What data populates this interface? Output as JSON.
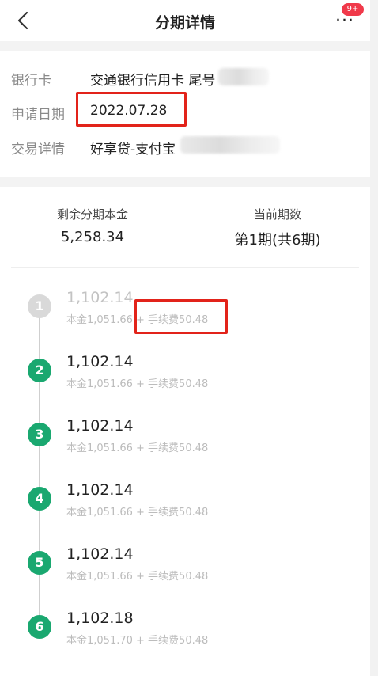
{
  "header": {
    "title": "分期详情",
    "back_icon": "chevron-left-icon",
    "more_icon": "more-dots-icon",
    "more_glyph": "···",
    "badge": "9+"
  },
  "info": {
    "bank_card_label": "银行卡",
    "bank_card_value": "交通银行信用卡  尾号",
    "apply_date_label": "申请日期",
    "apply_date_value": "2022.07.28",
    "transaction_label": "交易详情",
    "transaction_value": "好享贷-支付宝"
  },
  "summary": {
    "remaining_label": "剩余分期本金",
    "remaining_value": "5,258.34",
    "current_label": "当前期数",
    "current_value": "第1期(共6期)"
  },
  "installments": [
    {
      "num": "1",
      "amount": "1,102.14",
      "detail": "本金1,051.66 + 手续费50.48",
      "status": "done"
    },
    {
      "num": "2",
      "amount": "1,102.14",
      "detail": "本金1,051.66 + 手续费50.48",
      "status": "pending"
    },
    {
      "num": "3",
      "amount": "1,102.14",
      "detail": "本金1,051.66 + 手续费50.48",
      "status": "pending"
    },
    {
      "num": "4",
      "amount": "1,102.14",
      "detail": "本金1,051.66 + 手续费50.48",
      "status": "pending"
    },
    {
      "num": "5",
      "amount": "1,102.14",
      "detail": "本金1,051.66 + 手续费50.48",
      "status": "pending"
    },
    {
      "num": "6",
      "amount": "1,102.18",
      "detail": "本金1,051.70 + 手续费50.48",
      "status": "pending"
    }
  ],
  "colors": {
    "accent_green": "#1aa870",
    "done_gray": "#d9d9d9",
    "highlight_red": "#e2231a",
    "badge_red": "#f0394a"
  }
}
